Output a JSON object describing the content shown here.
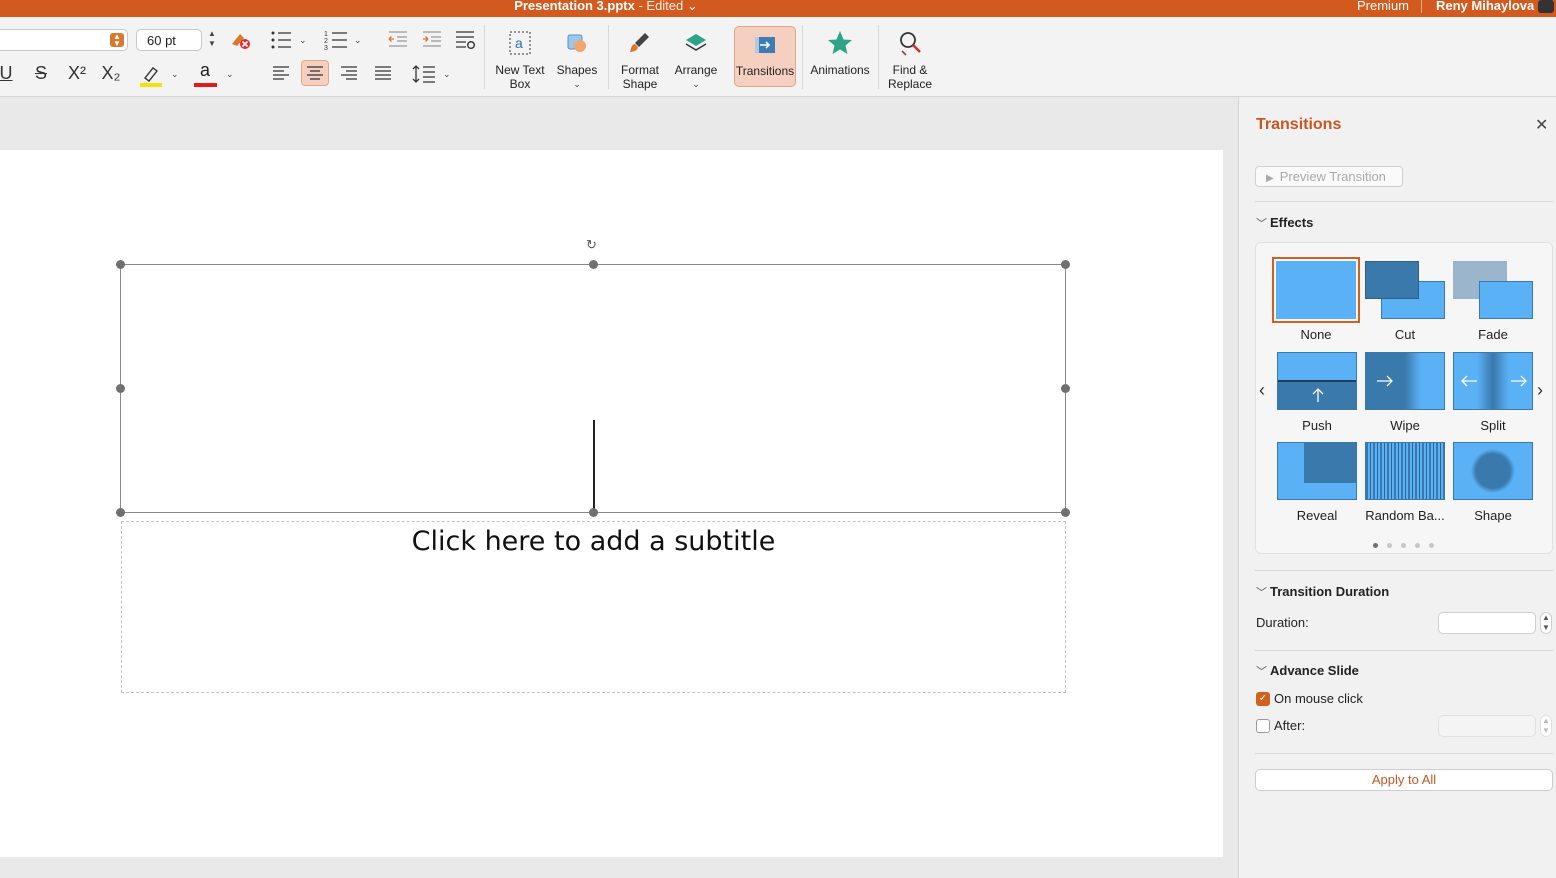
{
  "titlebar": {
    "document": "Presentation 3.pptx",
    "status": " - Edited",
    "caret": "⌄",
    "premium": "Premium",
    "user": "Reny Mihaylova"
  },
  "ribbon": {
    "font_size": "60 pt",
    "new_text_box": [
      "New Text",
      "Box"
    ],
    "shapes": "Shapes",
    "format_shape": [
      "Format",
      "Shape"
    ],
    "arrange": "Arrange",
    "transitions": "Transitions",
    "animations": "Animations",
    "find_replace": [
      "Find &",
      "Replace"
    ],
    "underline": "U",
    "strike": "S",
    "superscript": "X²",
    "subscript": "X₂",
    "font_color_letter": "a"
  },
  "colors": {
    "accent": "#d35a1f",
    "highlight": "#f5e10b",
    "font_color": "#e01d1d",
    "tile_light": "#5ab1f5",
    "tile_dark": "#3a79ab"
  },
  "slide": {
    "subtitle_placeholder": "Click here to add a subtitle"
  },
  "pane": {
    "title": "Transitions",
    "close": "✕",
    "preview": "Preview Transition",
    "effects_header": "Effects",
    "effects": [
      {
        "name": "None",
        "selected": true
      },
      {
        "name": "Cut"
      },
      {
        "name": "Fade"
      },
      {
        "name": "Push"
      },
      {
        "name": "Wipe"
      },
      {
        "name": "Split"
      },
      {
        "name": "Reveal"
      },
      {
        "name": "Random Ba..."
      },
      {
        "name": "Shape"
      }
    ],
    "gallery_page": 1,
    "gallery_pages": 5,
    "duration_header": "Transition Duration",
    "duration_label": "Duration:",
    "duration_value": "",
    "advance_header": "Advance Slide",
    "on_mouse_click": "On mouse click",
    "on_mouse_click_checked": true,
    "after_label": "After:",
    "after_checked": false,
    "apply_all": "Apply to All"
  }
}
